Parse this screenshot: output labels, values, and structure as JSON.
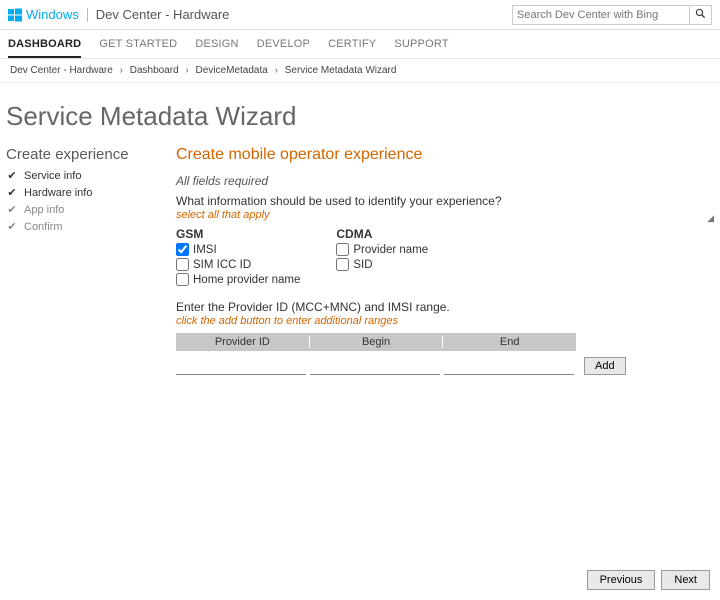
{
  "header": {
    "windows_label": "Windows",
    "site_name": "Dev Center - Hardware",
    "search_placeholder": "Search Dev Center with Bing"
  },
  "nav": {
    "tabs": [
      "DASHBOARD",
      "GET STARTED",
      "DESIGN",
      "DEVELOP",
      "CERTIFY",
      "SUPPORT"
    ],
    "active_index": 0
  },
  "breadcrumb": [
    "Dev Center - Hardware",
    "Dashboard",
    "DeviceMetadata",
    "Service Metadata Wizard"
  ],
  "page_title": "Service Metadata Wizard",
  "sidebar": {
    "title": "Create experience",
    "steps": [
      {
        "label": "Service info",
        "done": true,
        "active": true
      },
      {
        "label": "Hardware info",
        "done": true,
        "active": true
      },
      {
        "label": "App info",
        "done": false,
        "active": false
      },
      {
        "label": "Confirm",
        "done": false,
        "active": false
      }
    ]
  },
  "content": {
    "section_title": "Create mobile operator experience",
    "required_note": "All fields required",
    "identify_question": "What information should be used to identify your experience?",
    "select_hint": "select all that apply",
    "gsm_title": "GSM",
    "gsm_options": [
      {
        "label": "IMSI",
        "checked": true
      },
      {
        "label": "SIM ICC ID",
        "checked": false
      },
      {
        "label": "Home provider name",
        "checked": false
      }
    ],
    "cdma_title": "CDMA",
    "cdma_options": [
      {
        "label": "Provider name",
        "checked": false
      },
      {
        "label": "SID",
        "checked": false
      }
    ],
    "provider_question": "Enter the Provider ID (MCC+MNC) and IMSI range.",
    "range_hint": "click the add button to enter additional ranges",
    "columns": [
      "Provider ID",
      "Begin",
      "End"
    ],
    "add_label": "Add"
  },
  "footer": {
    "previous": "Previous",
    "next": "Next"
  }
}
